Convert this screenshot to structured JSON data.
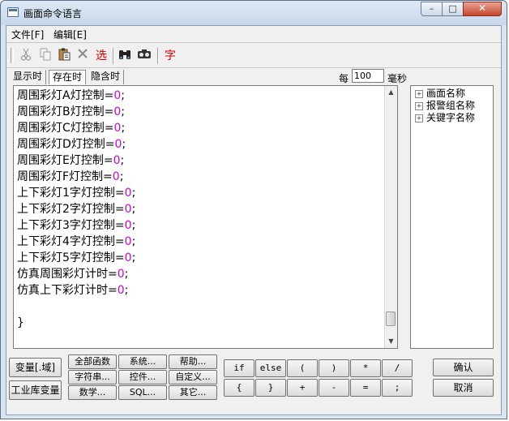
{
  "window": {
    "title": "画面命令语言"
  },
  "menu": [
    "文件[F]",
    "编辑[E]"
  ],
  "toolbar": {
    "select_label": "选",
    "font_label": "字"
  },
  "tabs": [
    "显示时",
    "存在时",
    "隐含时"
  ],
  "interval": {
    "prefix": "每",
    "value": "100",
    "unit": "毫秒"
  },
  "code": [
    {
      "text": "周围彩灯A灯控制=",
      "num": "0",
      "end": ";"
    },
    {
      "text": "周围彩灯B灯控制=",
      "num": "0",
      "end": ";"
    },
    {
      "text": "周围彩灯C灯控制=",
      "num": "0",
      "end": ";"
    },
    {
      "text": "周围彩灯D灯控制=",
      "num": "0",
      "end": ";"
    },
    {
      "text": "周围彩灯E灯控制=",
      "num": "0",
      "end": ";"
    },
    {
      "text": "周围彩灯F灯控制=",
      "num": "0",
      "end": ";"
    },
    {
      "text": "上下彩灯1字灯控制=",
      "num": "0",
      "end": ";"
    },
    {
      "text": "上下彩灯2字灯控制=",
      "num": "0",
      "end": ";"
    },
    {
      "text": "上下彩灯3字灯控制=",
      "num": "0",
      "end": ";"
    },
    {
      "text": "上下彩灯4字灯控制=",
      "num": "0",
      "end": ";"
    },
    {
      "text": "上下彩灯5字灯控制=",
      "num": "0",
      "end": ";"
    },
    {
      "text": "仿真周围彩灯计时=",
      "num": "0",
      "end": ";"
    },
    {
      "text": "仿真上下彩灯计时=",
      "num": "0",
      "end": ";"
    },
    {
      "text": "",
      "num": "",
      "end": ""
    },
    {
      "text": "}",
      "num": "",
      "end": ""
    }
  ],
  "tree": [
    "画面名称",
    "报警组名称",
    "关键字名称"
  ],
  "side_buttons": [
    "变量[.域]",
    "工业库变量"
  ],
  "function_buttons": [
    "全部函数",
    "系统...",
    "帮助...",
    "字符串...",
    "控件...",
    "自定义...",
    "数学...",
    "SQL...",
    "其它..."
  ],
  "operator_buttons": [
    "if",
    "else",
    "(",
    ")",
    "*",
    "/",
    "{",
    "}",
    "+",
    "-",
    "=",
    ";"
  ],
  "actions": {
    "ok": "确认",
    "cancel": "取消"
  }
}
